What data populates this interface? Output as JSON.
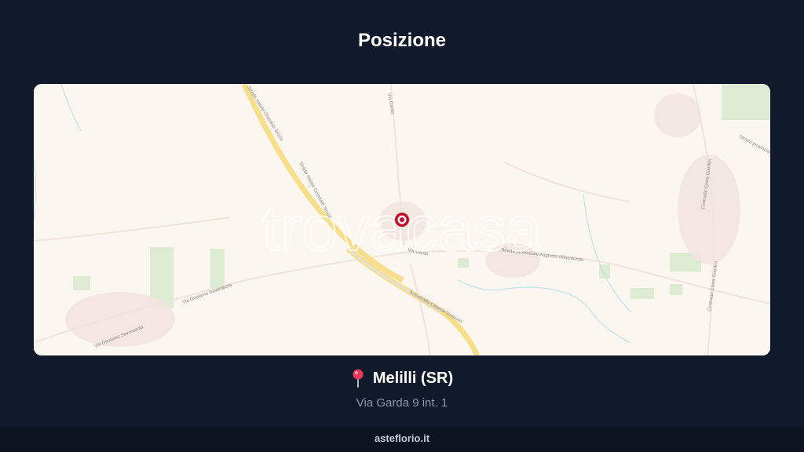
{
  "header": {
    "title": "Posizione"
  },
  "map": {
    "watermark": "trovacasa",
    "roads": {
      "via_garda_north": "Via Garda",
      "via_garda_south": "Via Garda",
      "statale_1": "Strada statale Orientale Sicula",
      "statale_2": "Strada statale Orientale Sicula",
      "provinciale_augusta": "Strada provinciale Augusta-Villasmundo",
      "autostrada": "Autostrada Catania-Siracusa",
      "savonarola_1": "Via Girolamo Savonarola",
      "savonarola_2": "Via Girolamo Savonarola",
      "contrada_1": "Contrada Costa Giardini",
      "contrada_2": "Contrada Costa Giardini",
      "provinciale_east": "Strada provinciale"
    },
    "marker_icon": "location-marker-icon"
  },
  "location": {
    "pin_icon": "map-pin-icon",
    "name": "Melilli (SR)",
    "address": "Via Garda 9 int. 1"
  },
  "footer": {
    "text": "asteflorio.it"
  }
}
